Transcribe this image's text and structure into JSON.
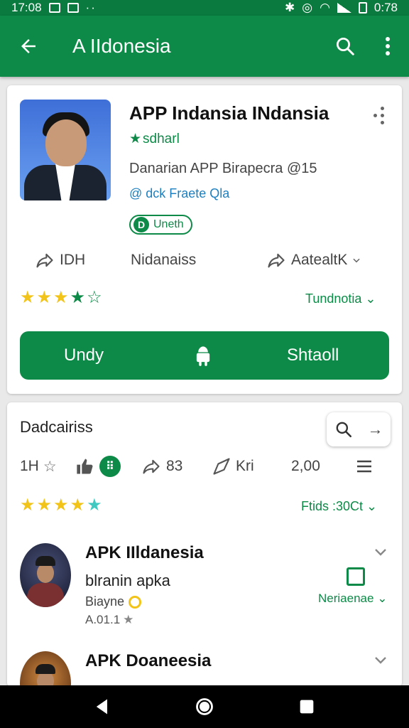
{
  "status_bar": {
    "time": "17:08",
    "right_text": "0:78"
  },
  "app_bar": {
    "title": "A IIdonesia"
  },
  "app": {
    "title": "APP Indansia INdansia",
    "developer": "sdharl",
    "description": "Danarian APP Birapecra @15",
    "link": "@ dck Fraete Qla",
    "badge_icon": "D",
    "badge": "Uneth",
    "stat1": "IDH",
    "stat2": "Nidanaiss",
    "stat3": "AatealtK",
    "rating_filter": "Tundnotia",
    "install_left": "Undy",
    "install_right": "Shtaoll"
  },
  "section": {
    "title": "Dadcairiss",
    "stat1": "1H",
    "stat3": "83",
    "stat4": "Kri",
    "stat5": "2,00",
    "filter": "Ftids :30Ct"
  },
  "list": [
    {
      "title": "APK IIldanesia",
      "subtitle": "blranin apka",
      "meta": "Biayne",
      "version": "A.01.1",
      "action": "Neriaenae"
    },
    {
      "title": "APK Doaneesia"
    }
  ],
  "colors": {
    "primary": "#0d8a47",
    "appbar": "#0d8a47",
    "star": "#f2c318",
    "link": "#1c7fbf"
  },
  "icons": [
    "back-arrow-icon",
    "search-icon",
    "more-vert-icon",
    "share-icon",
    "thumb-up-icon",
    "android-icon",
    "menu-icon",
    "chevron-down-icon",
    "edit-icon",
    "nav-back-icon",
    "nav-home-icon",
    "nav-recents-icon"
  ]
}
